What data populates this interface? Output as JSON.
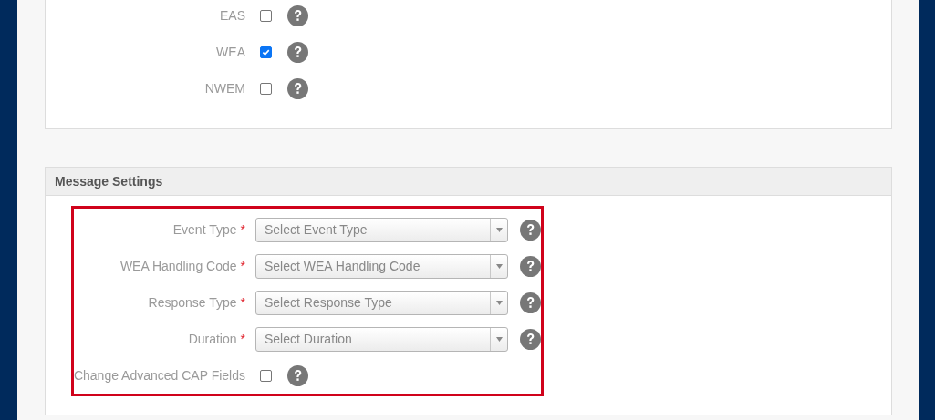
{
  "channels": [
    {
      "label": "EAS",
      "checked": false
    },
    {
      "label": "WEA",
      "checked": true
    },
    {
      "label": "NWEM",
      "checked": false
    }
  ],
  "message_settings": {
    "title": "Message Settings",
    "fields": [
      {
        "kind": "select",
        "label": "Event Type",
        "required_mark": "*",
        "placeholder": "Select Event Type"
      },
      {
        "kind": "select",
        "label": "WEA Handling Code",
        "required_mark": "*",
        "placeholder": "Select WEA Handling Code"
      },
      {
        "kind": "select",
        "label": "Response Type",
        "required_mark": "*",
        "placeholder": "Select Response Type"
      },
      {
        "kind": "select",
        "label": "Duration",
        "required_mark": "*",
        "placeholder": "Select Duration"
      },
      {
        "kind": "checkbox",
        "label": "Change Advanced CAP Fields",
        "checked": false
      }
    ]
  }
}
